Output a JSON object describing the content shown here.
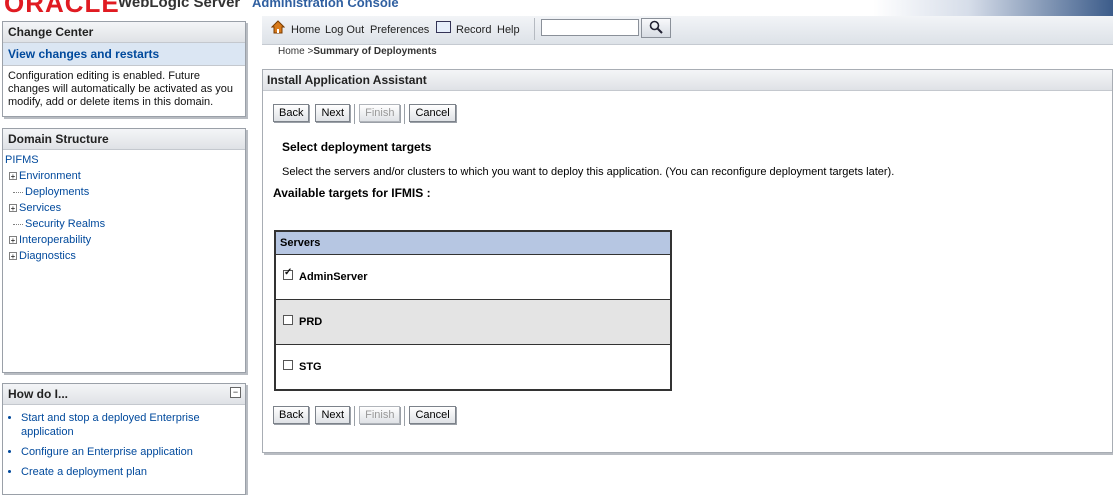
{
  "header": {
    "logo_text": "ORACLE",
    "product": "WebLogic Server",
    "product_suffix": "Administration Console"
  },
  "change_center": {
    "title": "Change Center",
    "link": "View changes and restarts",
    "message": "Configuration editing is enabled. Future changes will automatically be activated as you modify, add or delete items in this domain."
  },
  "domain_structure": {
    "title": "Domain Structure",
    "root": "PIFMS",
    "items": [
      {
        "label": "Environment",
        "expandable": true
      },
      {
        "label": "Deployments",
        "expandable": false
      },
      {
        "label": "Services",
        "expandable": true
      },
      {
        "label": "Security Realms",
        "expandable": false
      },
      {
        "label": "Interoperability",
        "expandable": true
      },
      {
        "label": "Diagnostics",
        "expandable": true
      }
    ]
  },
  "how_do_i": {
    "title": "How do I...",
    "items": [
      "Start and stop a deployed Enterprise application",
      "Configure an Enterprise application",
      "Create a deployment plan"
    ]
  },
  "toolbar": {
    "home": "Home",
    "logout": "Log Out",
    "preferences": "Preferences",
    "record": "Record",
    "help": "Help",
    "search_value": ""
  },
  "breadcrumb": {
    "home": "Home",
    "separator": ">",
    "current": "Summary of Deployments"
  },
  "assistant": {
    "title": "Install Application Assistant",
    "buttons": {
      "back": "Back",
      "next": "Next",
      "finish": "Finish",
      "cancel": "Cancel"
    },
    "step_title": "Select deployment targets",
    "step_desc": "Select the servers and/or clusters to which you want to deploy this application. (You can reconfigure deployment targets later).",
    "targets_label": "Available targets for IFMIS :",
    "servers_header": "Servers",
    "servers": [
      {
        "name": "AdminServer",
        "checked": true
      },
      {
        "name": "PRD",
        "checked": false
      },
      {
        "name": "STG",
        "checked": false
      }
    ]
  },
  "colors": {
    "link": "#00499c",
    "logo_red": "#e01b22",
    "table_header": "#b6c6e2"
  }
}
